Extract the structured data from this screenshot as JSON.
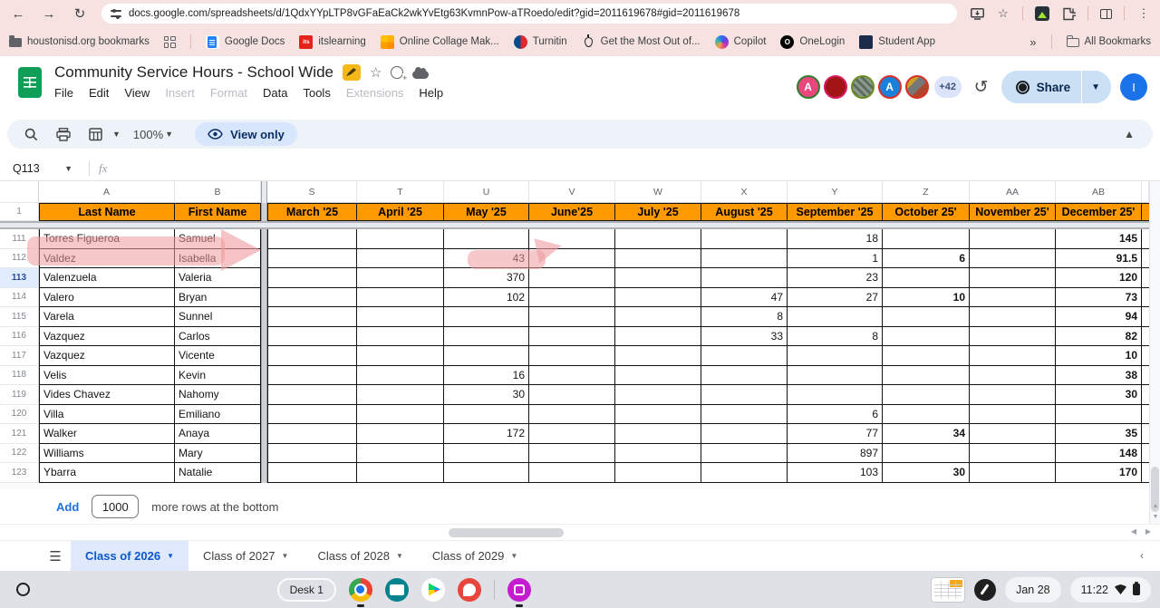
{
  "browser": {
    "url": "docs.google.com/spreadsheets/d/1QdxYYpLTP8vGFaEaCk2wkYvEtg63KvmnPow-aTRoedo/edit?gid=2011619678#gid=2011619678",
    "bookmarks_bar": {
      "folder_label": "houstonisd.org bookmarks",
      "items": [
        "Google Docs",
        "itslearning",
        "Online Collage Mak...",
        "Turnitin",
        "Get the Most Out of...",
        "Copilot",
        "OneLogin",
        "Student App"
      ],
      "overflow_chevron": "»",
      "all_bookmarks_label": "All Bookmarks"
    }
  },
  "doc": {
    "title": "Community Service Hours - School Wide",
    "menus": [
      {
        "label": "File",
        "disabled": false
      },
      {
        "label": "Edit",
        "disabled": false
      },
      {
        "label": "View",
        "disabled": false
      },
      {
        "label": "Insert",
        "disabled": true
      },
      {
        "label": "Format",
        "disabled": true
      },
      {
        "label": "Data",
        "disabled": false
      },
      {
        "label": "Tools",
        "disabled": false
      },
      {
        "label": "Extensions",
        "disabled": true
      },
      {
        "label": "Help",
        "disabled": false
      }
    ],
    "collaborators": {
      "initial_1": "A",
      "initial_4": "A",
      "more_badge": "+42"
    },
    "share_label": "Share",
    "account_initial": "I"
  },
  "toolbar": {
    "zoom_level": "100%",
    "view_only_label": "View only"
  },
  "formula_bar": {
    "name_box": "Q113",
    "fx_label": "fx"
  },
  "sheet": {
    "col_letters": [
      "A",
      "B",
      "S",
      "T",
      "U",
      "V",
      "W",
      "X",
      "Y",
      "Z",
      "AA",
      "AB"
    ],
    "header_row_number": "1",
    "name_headers": {
      "last": "Last Name",
      "first": "First Name"
    },
    "month_headers": [
      "March '25",
      "April '25",
      "May '25",
      "June'25",
      "July '25",
      "August '25",
      "September '25",
      "October 25'",
      "November 25'",
      "December 25'"
    ],
    "selected_row": "113",
    "rows": [
      {
        "n": "111",
        "last": "Torres Figueroa",
        "first": "Samuel",
        "months": [
          "",
          "",
          "",
          "",
          "",
          "",
          "18",
          "",
          "",
          "145"
        ]
      },
      {
        "n": "112",
        "last": "Valdez",
        "first": "Isabella",
        "months": [
          "",
          "",
          "43",
          "",
          "",
          "",
          "1",
          "6",
          "",
          "91.5"
        ]
      },
      {
        "n": "113",
        "last": "Valenzuela",
        "first": "Valeria",
        "months": [
          "",
          "",
          "370",
          "",
          "",
          "",
          "23",
          "",
          "",
          "120"
        ]
      },
      {
        "n": "114",
        "last": "Valero",
        "first": "Bryan",
        "months": [
          "",
          "",
          "102",
          "",
          "",
          "47",
          "27",
          "10",
          "",
          "73"
        ]
      },
      {
        "n": "115",
        "last": "Varela",
        "first": "Sunnel",
        "months": [
          "",
          "",
          "",
          "",
          "",
          "8",
          "",
          "",
          "",
          "94"
        ]
      },
      {
        "n": "116",
        "last": "Vazquez",
        "first": "Carlos",
        "months": [
          "",
          "",
          "",
          "",
          "",
          "33",
          "8",
          "",
          "",
          "82"
        ]
      },
      {
        "n": "117",
        "last": "Vazquez",
        "first": "Vicente",
        "months": [
          "",
          "",
          "",
          "",
          "",
          "",
          "",
          "",
          "",
          "10"
        ]
      },
      {
        "n": "118",
        "last": "Velis",
        "first": "Kevin",
        "months": [
          "",
          "",
          "16",
          "",
          "",
          "",
          "",
          "",
          "",
          "38"
        ]
      },
      {
        "n": "119",
        "last": "Vides Chavez",
        "first": "Nahomy",
        "months": [
          "",
          "",
          "30",
          "",
          "",
          "",
          "",
          "",
          "",
          "30"
        ]
      },
      {
        "n": "120",
        "last": "Villa",
        "first": "Emiliano",
        "months": [
          "",
          "",
          "",
          "",
          "",
          "",
          "6",
          "",
          "",
          ""
        ]
      },
      {
        "n": "121",
        "last": "Walker",
        "first": "Anaya",
        "months": [
          "",
          "",
          "172",
          "",
          "",
          "",
          "77",
          "34",
          "",
          "35"
        ]
      },
      {
        "n": "122",
        "last": "Williams",
        "first": "Mary",
        "months": [
          "",
          "",
          "",
          "",
          "",
          "",
          "897",
          "",
          "",
          "148"
        ]
      },
      {
        "n": "123",
        "last": "Ybarra",
        "first": "Natalie",
        "months": [
          "",
          "",
          "",
          "",
          "",
          "",
          "103",
          "30",
          "",
          "170"
        ]
      }
    ]
  },
  "footer": {
    "add_label": "Add",
    "rows_count": "1000",
    "suffix": "more rows at the bottom"
  },
  "tabs": [
    {
      "label": "Class of 2026",
      "active": true
    },
    {
      "label": "Class of 2027",
      "active": false
    },
    {
      "label": "Class of 2028",
      "active": false
    },
    {
      "label": "Class of 2029",
      "active": false
    }
  ],
  "taskbar": {
    "desk_label": "Desk 1",
    "date": "Jan 28",
    "time": "11:22"
  },
  "colors": {
    "header_orange": "#ff9900",
    "active_tab_blue": "#0b57d0",
    "chrome_theme_pink": "#f6e3e1",
    "annotation_pink": "#ee9a9e"
  }
}
